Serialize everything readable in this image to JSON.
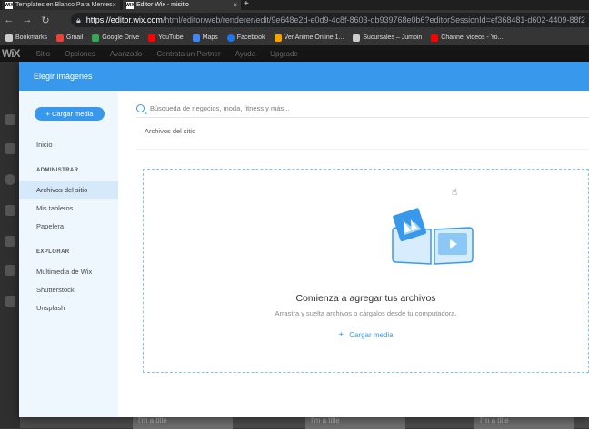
{
  "browser": {
    "tabs": [
      {
        "favicon": "WIX",
        "title": "Templates en Blanco Para Mentes"
      },
      {
        "favicon": "WIX",
        "title": "Editor Wix - misitio"
      }
    ],
    "new_tab": "+",
    "url_host": "https://editor.wix.com",
    "url_path": "/html/editor/web/renderer/edit/9e648e2d-e0d9-4c8f-8603-db939768e0b6?editorSessionId=ef368481-d602-4409-88f2",
    "bookmarks": [
      {
        "label": "Bookmarks",
        "color": "#cccccc"
      },
      {
        "label": "Gmail",
        "color": "#ea4335"
      },
      {
        "label": "Google Drive",
        "color": "#34a853"
      },
      {
        "label": "YouTube",
        "color": "#ff0000"
      },
      {
        "label": "Maps",
        "color": "#4285f4"
      },
      {
        "label": "Facebook",
        "color": "#1877f2"
      },
      {
        "label": "Ver Anime Online 1...",
        "color": "#f4a300"
      },
      {
        "label": "Sucursales – Jumpin",
        "color": "#cccccc"
      },
      {
        "label": "Channel videos - Yo...",
        "color": "#ff0000"
      }
    ]
  },
  "editor": {
    "logo": "WiX",
    "menu": [
      "Sitio",
      "Opciones",
      "Avanzado",
      "Contrata un Partner",
      "Ayuda",
      "Upgrade"
    ],
    "bottom_cards": [
      "I'm a title",
      "I'm a title",
      "I'm a title"
    ]
  },
  "modal": {
    "title": "Elegir imágenes",
    "upload_button": "+ Cargar media",
    "sidebar": {
      "home": "Inicio",
      "section_admin": "ADMINISTRAR",
      "admin_items": [
        "Archivos del sitio",
        "Mis tableros",
        "Papelera"
      ],
      "section_explore": "EXPLORAR",
      "explore_items": [
        "Multimedia de Wix",
        "Shutterstock",
        "Unsplash"
      ]
    },
    "search_placeholder": "Búsqueda de negocios, moda, fitness y más...",
    "section_title": "Archivos del sitio",
    "dropzone": {
      "title": "Comienza a agregar tus archivos",
      "subtitle": "Arrastra y suelta archivos o cárgalos desde tu computadora.",
      "link": "Cargar media"
    }
  },
  "colors": {
    "accent": "#3899ec",
    "sidebar_bg": "#eef6fe",
    "active_item": "#d6e9fb"
  }
}
